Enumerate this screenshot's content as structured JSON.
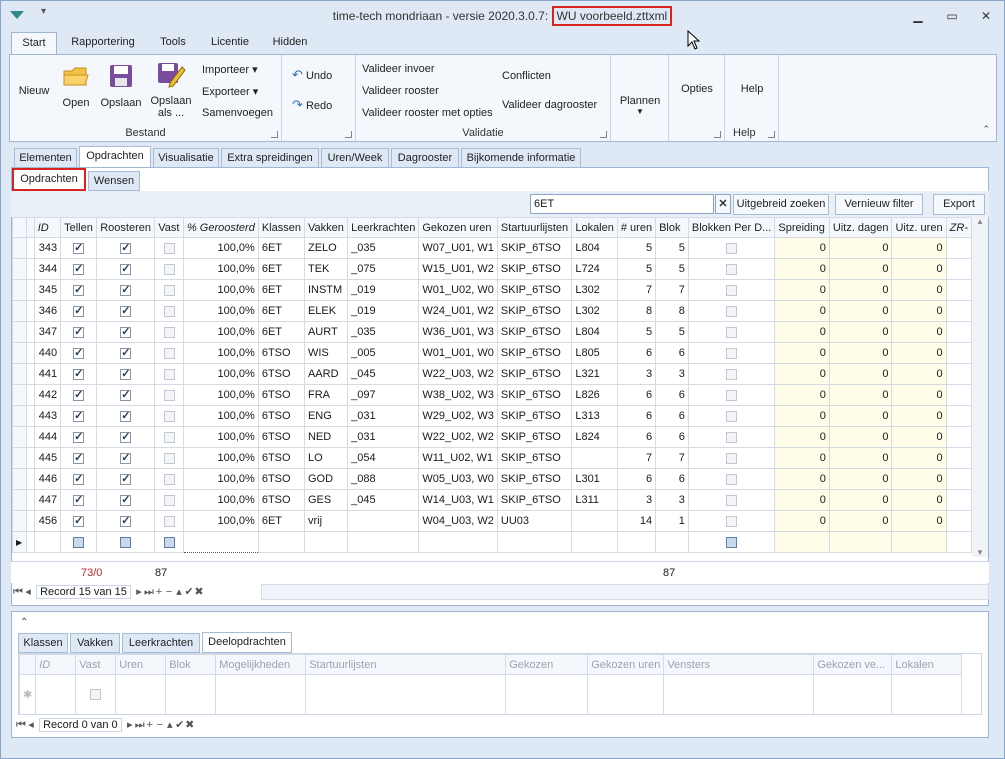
{
  "window": {
    "title_prefix": "time-tech mondriaan - versie 2020.3.0.7: ",
    "title_file": "WU voorbeeld.zttxml",
    "controls": [
      "▁",
      "▭",
      "✕"
    ]
  },
  "ribbon_tabs": [
    "Start",
    "Rapportering",
    "Tools",
    "Licentie",
    "Hidden"
  ],
  "ribbon": {
    "bestand": {
      "label": "Bestand",
      "nieuw": "Nieuw",
      "open": "Open",
      "opslaan": "Opslaan",
      "opslaan_als_1": "Opslaan",
      "opslaan_als_2": "als ...",
      "importeer": "Importeer ▾",
      "exporteer": "Exporteer ▾",
      "samenvoegen": "Samenvoegen"
    },
    "undo": {
      "undo": "Undo",
      "redo": "Redo"
    },
    "validatie": {
      "label": "Validatie",
      "valideer_invoer": "Valideer invoer",
      "valideer_rooster": "Valideer rooster",
      "valideer_opties": "Valideer rooster met opties",
      "conflicten": "Conflicten",
      "valideer_dagrooster": "Valideer dagrooster"
    },
    "plannen": "Plannen",
    "opties": "Opties",
    "help": "Help",
    "help_label": "Help"
  },
  "page_tabs": [
    "Elementen",
    "Opdrachten",
    "Visualisatie",
    "Extra spreidingen",
    "Uren/Week",
    "Dagrooster",
    "Bijkomende informatie"
  ],
  "sub_tabs": [
    "Opdrachten",
    "Wensen"
  ],
  "filter": {
    "value": "6ET",
    "uitgebreid": "Uitgebreid zoeken",
    "vernieuw": "Vernieuw filter",
    "export": "Export"
  },
  "grid": {
    "columns": [
      "ID",
      "Tellen",
      "Roosteren",
      "Vast",
      "% Geroosterd",
      "Klassen",
      "Vakken",
      "Leerkrachten",
      "Gekozen uren",
      "Startuurlijsten",
      "Lokalen",
      "# uren",
      "Blok",
      "Blokken Per D...",
      "Spreiding",
      "Uitz. dagen",
      "Uitz. uren",
      "ZR-"
    ],
    "rows": [
      {
        "id": "343",
        "tellen": true,
        "roosteren": true,
        "vast": false,
        "pct": "100,0%",
        "klassen": "6ET",
        "vakken": "ZELO",
        "lk": "_035",
        "gekozen": "W07_U01, W1",
        "start": "SKIP_6TSO",
        "lokalen": "L804",
        "uren": "5",
        "blok": "5",
        "spreiding": "0",
        "udagen": "0",
        "uuren": "0"
      },
      {
        "id": "344",
        "tellen": true,
        "roosteren": true,
        "vast": false,
        "pct": "100,0%",
        "klassen": "6ET",
        "vakken": "TEK",
        "lk": "_075",
        "gekozen": "W15_U01, W2",
        "start": "SKIP_6TSO",
        "lokalen": "L724",
        "uren": "5",
        "blok": "5",
        "spreiding": "0",
        "udagen": "0",
        "uuren": "0"
      },
      {
        "id": "345",
        "tellen": true,
        "roosteren": true,
        "vast": false,
        "pct": "100,0%",
        "klassen": "6ET",
        "vakken": "INSTM",
        "lk": "_019",
        "gekozen": "W01_U02, W0",
        "start": "SKIP_6TSO",
        "lokalen": "L302",
        "uren": "7",
        "blok": "7",
        "spreiding": "0",
        "udagen": "0",
        "uuren": "0"
      },
      {
        "id": "346",
        "tellen": true,
        "roosteren": true,
        "vast": false,
        "pct": "100,0%",
        "klassen": "6ET",
        "vakken": "ELEK",
        "lk": "_019",
        "gekozen": "W24_U01, W2",
        "start": "SKIP_6TSO",
        "lokalen": "L302",
        "uren": "8",
        "blok": "8",
        "spreiding": "0",
        "udagen": "0",
        "uuren": "0"
      },
      {
        "id": "347",
        "tellen": true,
        "roosteren": true,
        "vast": false,
        "pct": "100,0%",
        "klassen": "6ET",
        "vakken": "AURT",
        "lk": "_035",
        "gekozen": "W36_U01, W3",
        "start": "SKIP_6TSO",
        "lokalen": "L804",
        "uren": "5",
        "blok": "5",
        "spreiding": "0",
        "udagen": "0",
        "uuren": "0"
      },
      {
        "id": "440",
        "tellen": true,
        "roosteren": true,
        "vast": false,
        "pct": "100,0%",
        "klassen": "6TSO",
        "vakken": "WIS",
        "lk": "_005",
        "gekozen": "W01_U01, W0",
        "start": "SKIP_6TSO",
        "lokalen": "L805",
        "uren": "6",
        "blok": "6",
        "spreiding": "0",
        "udagen": "0",
        "uuren": "0"
      },
      {
        "id": "441",
        "tellen": true,
        "roosteren": true,
        "vast": false,
        "pct": "100,0%",
        "klassen": "6TSO",
        "vakken": "AARD",
        "lk": "_045",
        "gekozen": "W22_U03, W2",
        "start": "SKIP_6TSO",
        "lokalen": "L321",
        "uren": "3",
        "blok": "3",
        "spreiding": "0",
        "udagen": "0",
        "uuren": "0"
      },
      {
        "id": "442",
        "tellen": true,
        "roosteren": true,
        "vast": false,
        "pct": "100,0%",
        "klassen": "6TSO",
        "vakken": "FRA",
        "lk": "_097",
        "gekozen": "W38_U02, W3",
        "start": "SKIP_6TSO",
        "lokalen": "L826",
        "uren": "6",
        "blok": "6",
        "spreiding": "0",
        "udagen": "0",
        "uuren": "0"
      },
      {
        "id": "443",
        "tellen": true,
        "roosteren": true,
        "vast": false,
        "pct": "100,0%",
        "klassen": "6TSO",
        "vakken": "ENG",
        "lk": "_031",
        "gekozen": "W29_U02, W3",
        "start": "SKIP_6TSO",
        "lokalen": "L313",
        "uren": "6",
        "blok": "6",
        "spreiding": "0",
        "udagen": "0",
        "uuren": "0"
      },
      {
        "id": "444",
        "tellen": true,
        "roosteren": true,
        "vast": false,
        "pct": "100,0%",
        "klassen": "6TSO",
        "vakken": "NED",
        "lk": "_031",
        "gekozen": "W22_U02, W2",
        "start": "SKIP_6TSO",
        "lokalen": "L824",
        "uren": "6",
        "blok": "6",
        "spreiding": "0",
        "udagen": "0",
        "uuren": "0"
      },
      {
        "id": "445",
        "tellen": true,
        "roosteren": true,
        "vast": false,
        "pct": "100,0%",
        "klassen": "6TSO",
        "vakken": "LO",
        "lk": "_054",
        "gekozen": "W11_U02, W1",
        "start": "SKIP_6TSO",
        "lokalen": "",
        "uren": "7",
        "blok": "7",
        "spreiding": "0",
        "udagen": "0",
        "uuren": "0"
      },
      {
        "id": "446",
        "tellen": true,
        "roosteren": true,
        "vast": false,
        "pct": "100,0%",
        "klassen": "6TSO",
        "vakken": "GOD",
        "lk": "_088",
        "gekozen": "W05_U03, W0",
        "start": "SKIP_6TSO",
        "lokalen": "L301",
        "uren": "6",
        "blok": "6",
        "spreiding": "0",
        "udagen": "0",
        "uuren": "0"
      },
      {
        "id": "447",
        "tellen": true,
        "roosteren": true,
        "vast": false,
        "pct": "100,0%",
        "klassen": "6TSO",
        "vakken": "GES",
        "lk": "_045",
        "gekozen": "W14_U03, W1",
        "start": "SKIP_6TSO",
        "lokalen": "L311",
        "uren": "3",
        "blok": "3",
        "spreiding": "0",
        "udagen": "0",
        "uuren": "0"
      },
      {
        "id": "456",
        "tellen": true,
        "roosteren": true,
        "vast": false,
        "pct": "100,0%",
        "klassen": "6ET",
        "vakken": "vrij",
        "lk": "",
        "gekozen": "W04_U03, W2",
        "start": "UU03",
        "lokalen": "",
        "uren": "14",
        "blok": "1",
        "spreiding": "0",
        "udagen": "0",
        "uuren": "0"
      }
    ],
    "summary": {
      "tellen": "73/0",
      "roosteren": "87",
      "uren": "87"
    },
    "record_nav": "Record 15 van 15"
  },
  "lower": {
    "tabs": [
      "Klassen",
      "Vakken",
      "Leerkrachten",
      "Deelopdrachten"
    ],
    "columns": [
      "ID",
      "Vast",
      "Uren",
      "Blok",
      "Mogelijkheden",
      "Startuurlijsten",
      "Gekozen",
      "Gekozen uren",
      "Vensters",
      "Gekozen ve...",
      "Lokalen"
    ],
    "record_nav": "Record 0 van 0"
  }
}
